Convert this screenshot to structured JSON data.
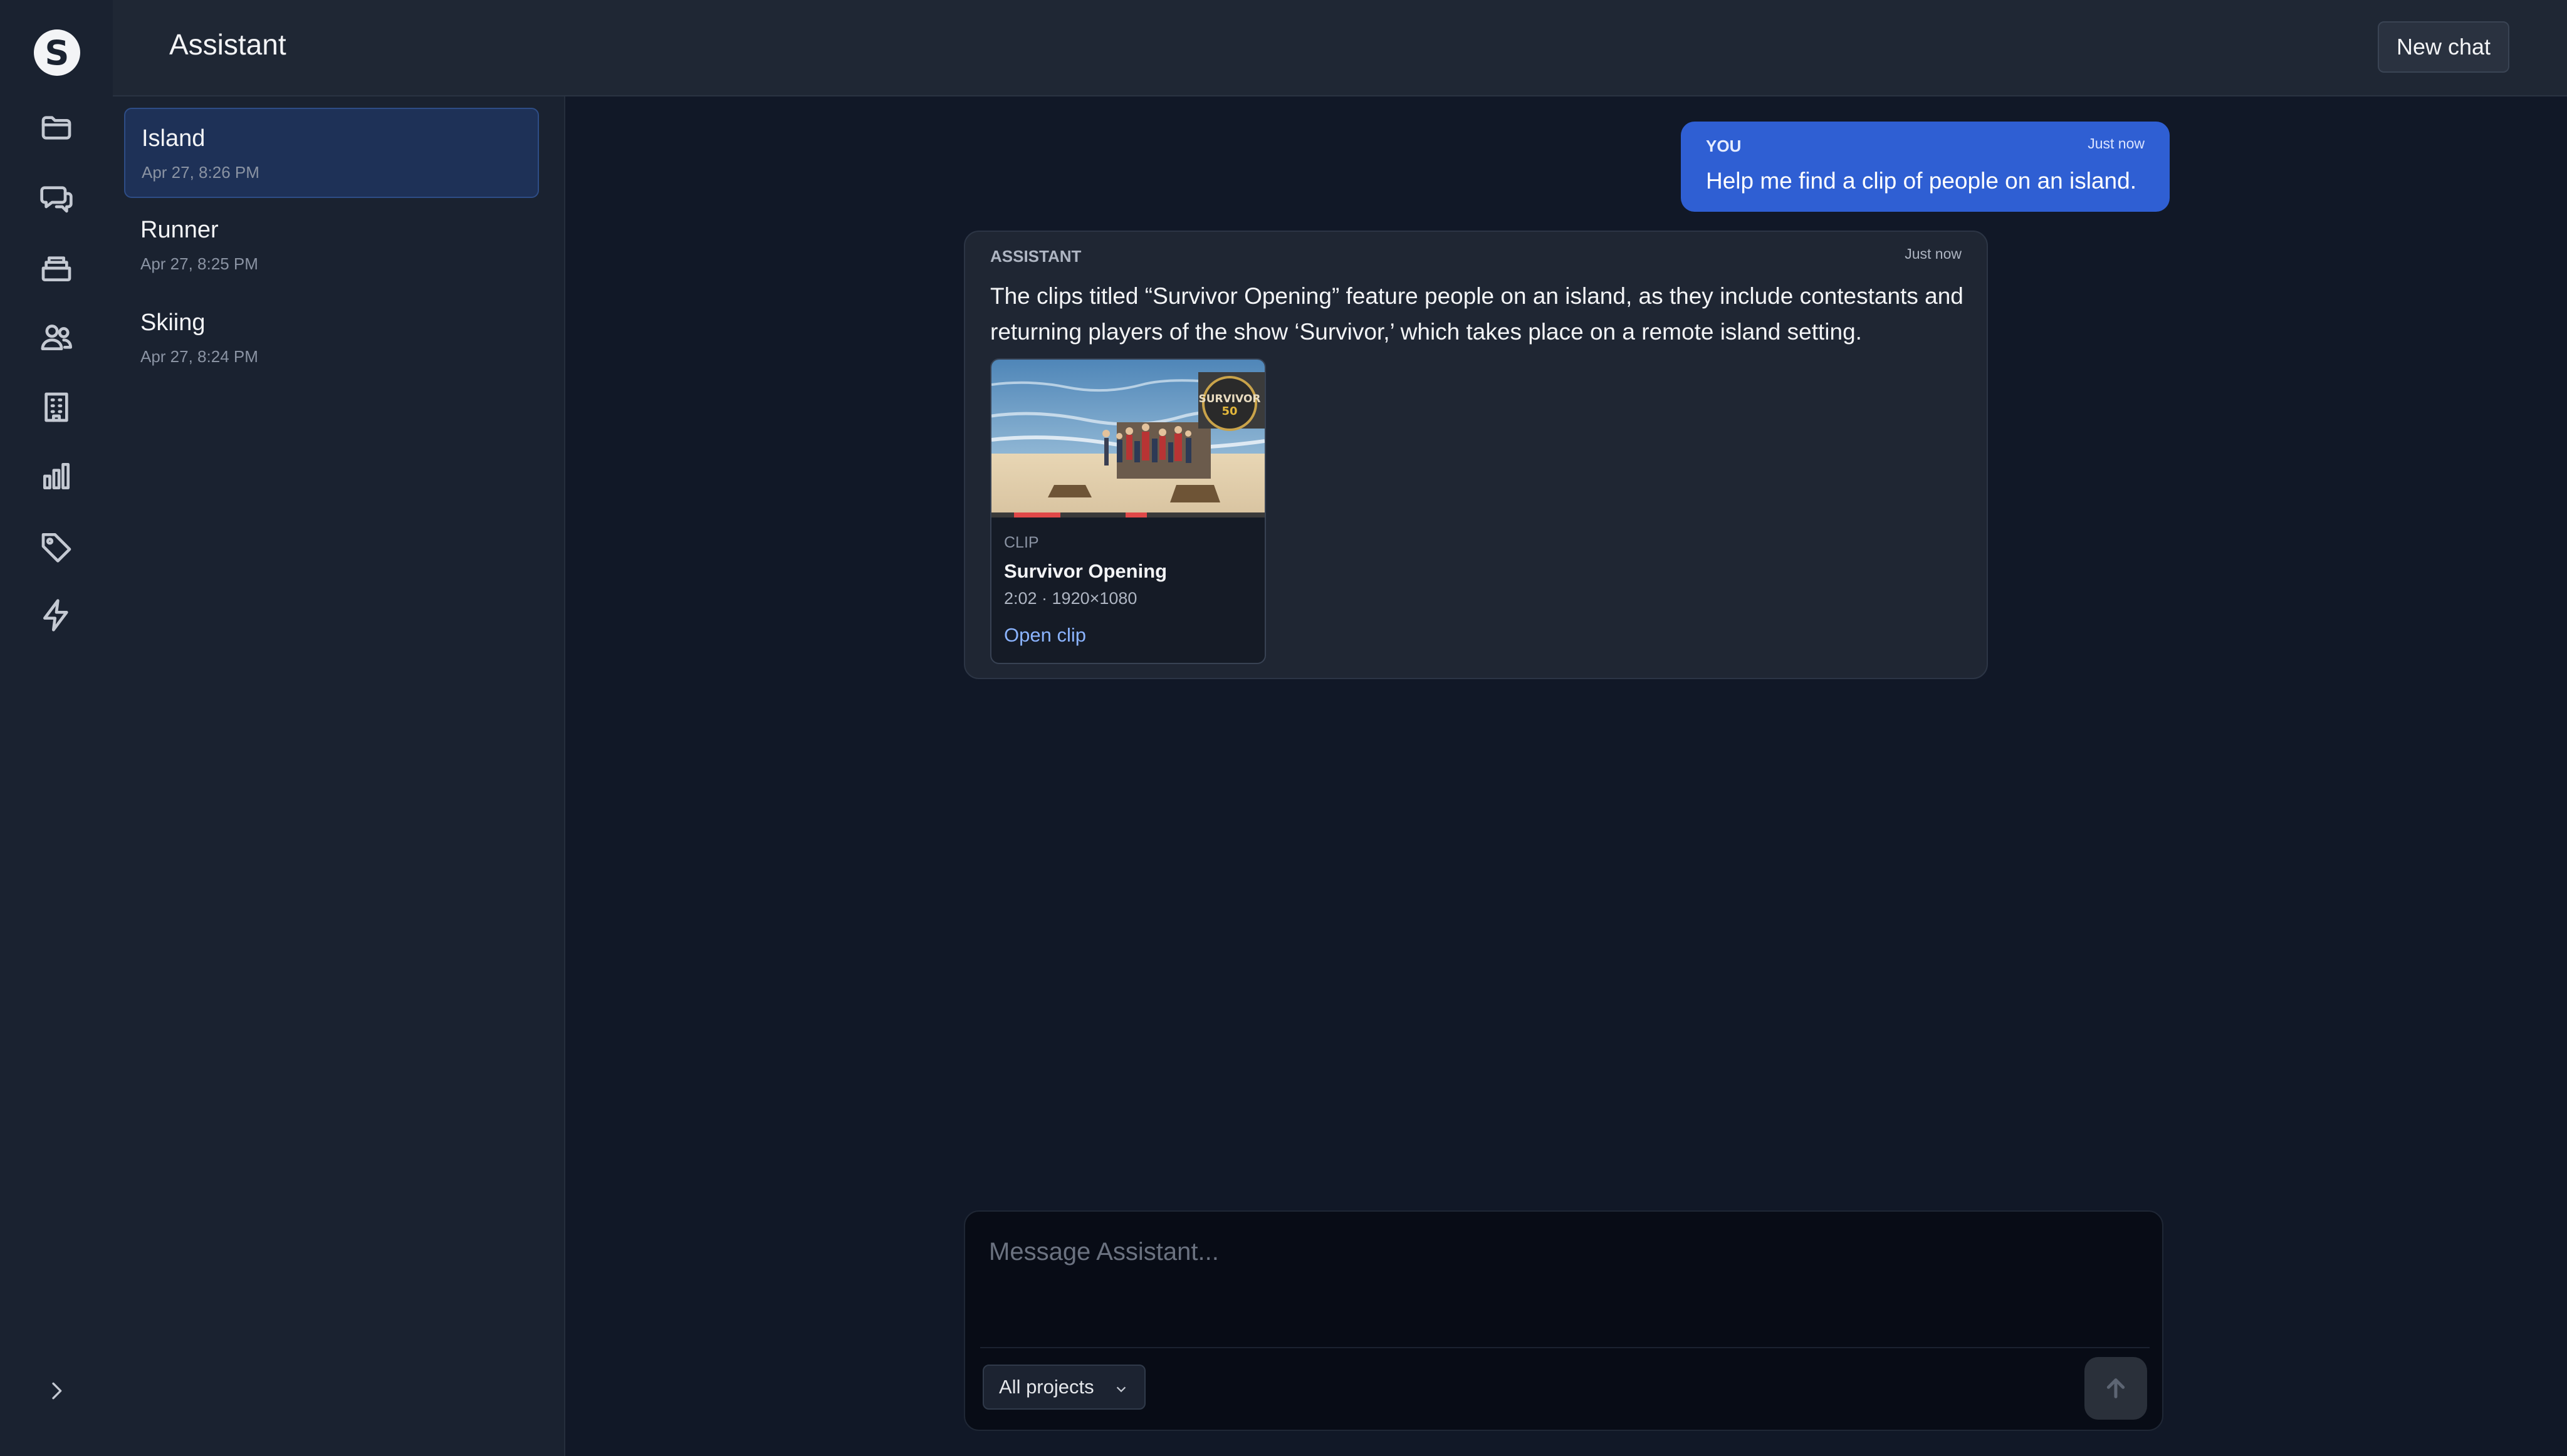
{
  "app": {
    "title": "Assistant",
    "new_chat_label": "New chat",
    "logo_letter": "S"
  },
  "rail": {
    "items": [
      "folder-icon",
      "chat-icon",
      "archive-icon",
      "users-icon",
      "building-icon",
      "chart-icon",
      "tag-icon",
      "bolt-icon"
    ]
  },
  "sessions": [
    {
      "name": "Island",
      "time": "Apr 27, 8:26 PM",
      "active": true
    },
    {
      "name": "Runner",
      "time": "Apr 27, 8:25 PM",
      "active": false
    },
    {
      "name": "Skiing",
      "time": "Apr 27, 8:24 PM",
      "active": false
    }
  ],
  "messages": {
    "user": {
      "who": "YOU",
      "when": "Just now",
      "text": "Help me find a clip of people on an island."
    },
    "assistant": {
      "who": "ASSISTANT",
      "when": "Just now",
      "text": "The clips titled “Survivor Opening” feature people on an island, as they include contestants and returning players of the show ‘Survivor,’ which takes place on a remote island setting.",
      "clip": {
        "kind": "CLIP",
        "name": "Survivor Opening",
        "meta": "2:02 · 1920×1080",
        "open_label": "Open clip",
        "badge_text": "SURVIVOR",
        "badge_number": "50"
      }
    }
  },
  "composer": {
    "placeholder": "Message Assistant...",
    "scope_label": "All projects"
  },
  "colors": {
    "accent": "#2f5fd3",
    "link": "#8bb4ff",
    "active_session": "#1e3157"
  }
}
